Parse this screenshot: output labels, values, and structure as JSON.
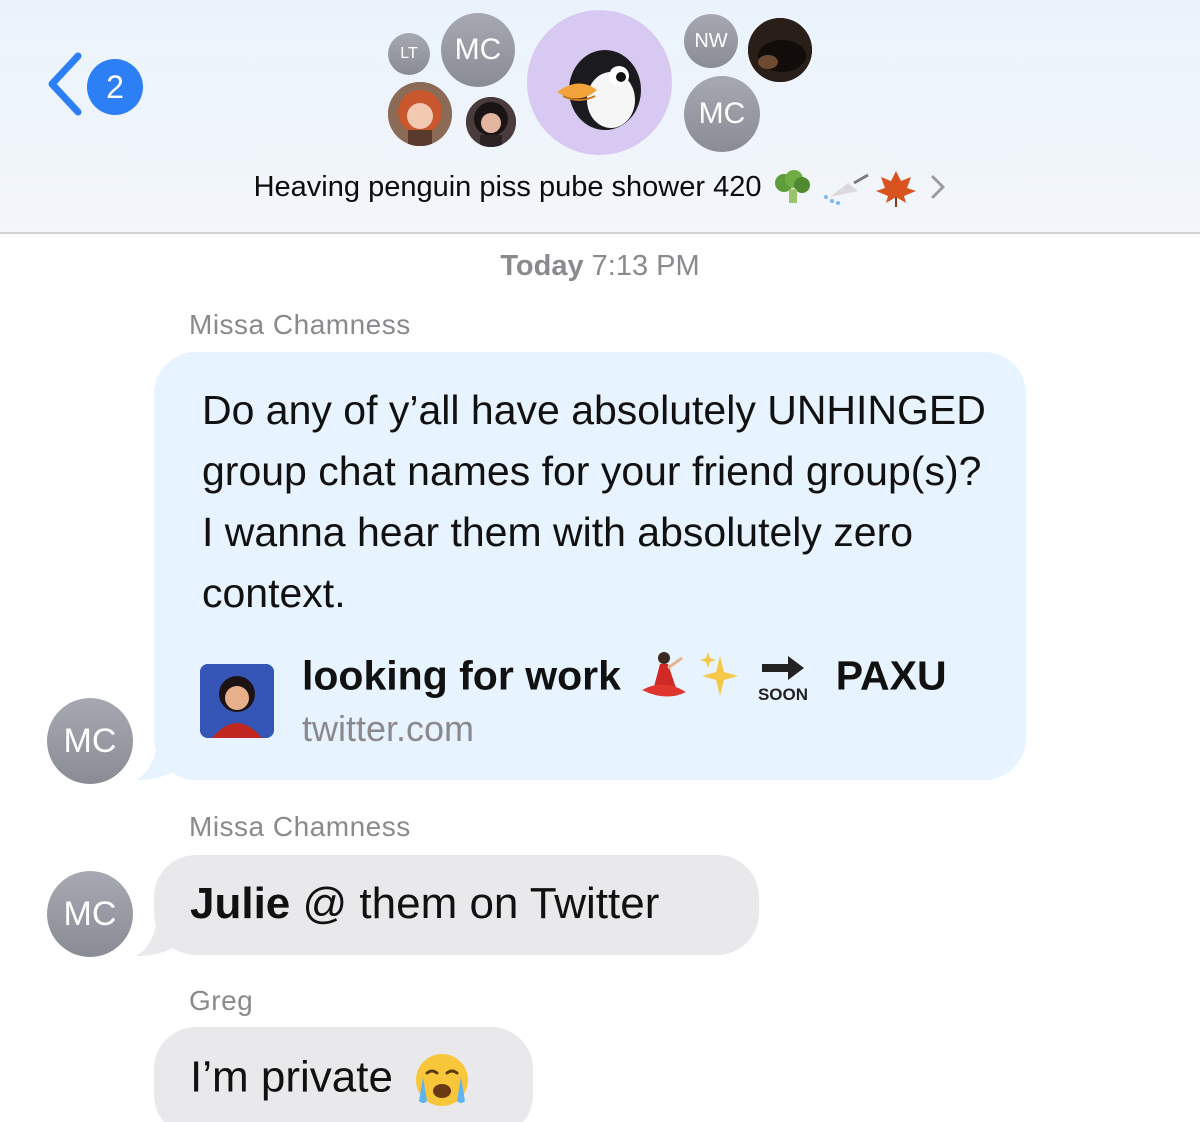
{
  "header": {
    "unread_count": "2",
    "avatars": {
      "lt": "LT",
      "mc_top": "MC",
      "nw": "NW",
      "mc_bottom": "MC"
    },
    "group_title": "Heaving penguin piss pube shower 420"
  },
  "conversation": {
    "timestamp_day": "Today",
    "timestamp_time": "7:13 PM",
    "messages": [
      {
        "sender": "Missa Chamness",
        "avatar_initials": "MC",
        "text": "Do any of y’all have absolutely UNHINGED group chat names for your friend group(s)? I wanna hear them with absolutely zero context.",
        "link_preview": {
          "title_start": "looking for work",
          "title_end": "PAXU",
          "domain": "twitter.com"
        }
      },
      {
        "sender": "Missa Chamness",
        "avatar_initials": "MC",
        "mention": "Julie",
        "text": " @ them on Twitter"
      },
      {
        "sender": "Greg",
        "text": "I’m private"
      }
    ]
  },
  "colors": {
    "accent_blue": "#2d7ff6",
    "incoming_bubble_blue": "#e7f3fe",
    "incoming_bubble_grey": "#e9e9eb",
    "secondary_text": "#8a8a8e"
  }
}
